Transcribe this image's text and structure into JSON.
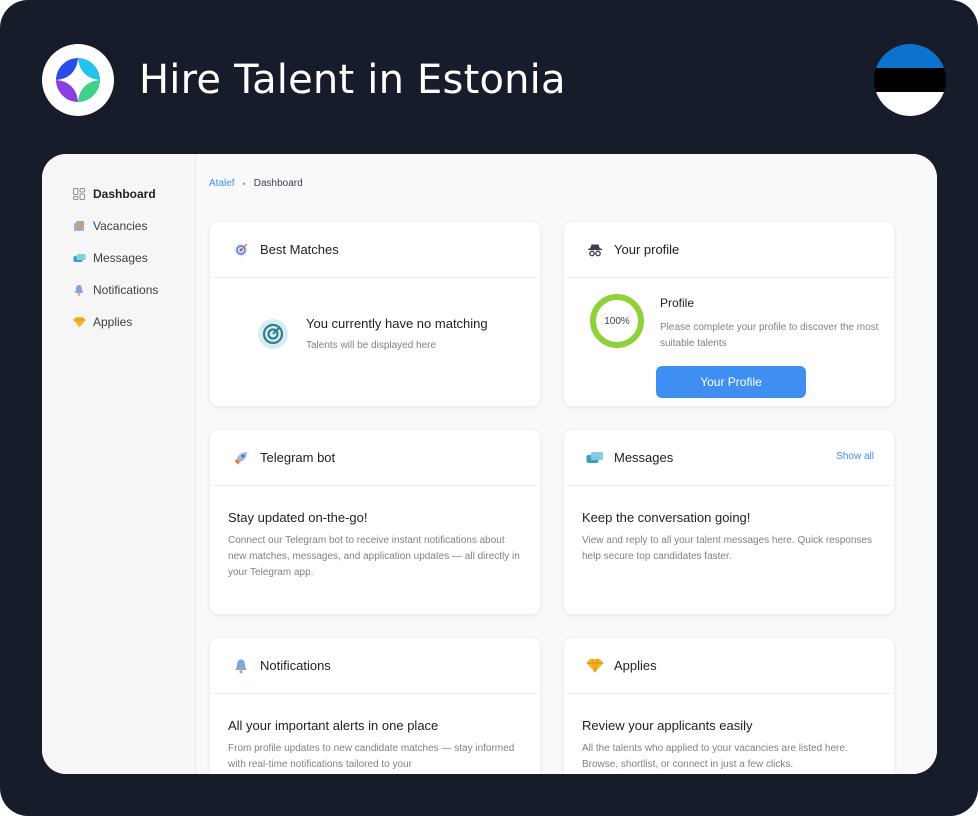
{
  "banner": {
    "headline": "Hire Talent in Estonia"
  },
  "flag": {
    "colors": [
      "#0b72ce",
      "#000000",
      "#ffffff"
    ]
  },
  "sidebar": {
    "items": [
      {
        "label": "Dashboard",
        "icon": "dashboard-icon",
        "active": true
      },
      {
        "label": "Vacancies",
        "icon": "vacancies-icon"
      },
      {
        "label": "Messages",
        "icon": "messages-icon"
      },
      {
        "label": "Notifications",
        "icon": "bell-icon"
      },
      {
        "label": "Applies",
        "icon": "diamond-icon"
      }
    ]
  },
  "breadcrumb": {
    "root": "Atalef",
    "separator": "•",
    "current": "Dashboard"
  },
  "cards": {
    "best_matches": {
      "title": "Best Matches",
      "icon": "target-icon",
      "empty_title": "You currently have no matching",
      "empty_text": "Talents will be displayed here"
    },
    "profile": {
      "title": "Your profile",
      "icon": "spy-icon",
      "progress_label": "100%",
      "progress": 1.0,
      "heading": "Profile",
      "text": "Please complete your profile to discover the most suitable talents",
      "button": "Your Profile"
    },
    "telegram": {
      "title": "Telegram bot",
      "icon": "rocket-icon",
      "heading": "Stay updated on-the-go!",
      "text": "Connect our Telegram bot to receive instant notifications about new matches, messages, and application updates — all directly in your Telegram app."
    },
    "messages": {
      "title": "Messages",
      "icon": "chat-icon",
      "link": "Show all",
      "heading": "Keep the conversation going!",
      "text": "View and reply to all your talent messages here. Quick responses help secure top candidates faster."
    },
    "notifications": {
      "title": "Notifications",
      "icon": "bell-icon",
      "heading": "All your important alerts in one place",
      "text": "From profile updates to new candidate matches — stay informed with real-time notifications tailored to your"
    },
    "applies": {
      "title": "Applies",
      "icon": "diamond-icon",
      "heading": "Review your applicants easily",
      "text": "All the talents who applied to your vacancies are listed here. Browse, shortlist, or connect in just a few clicks."
    }
  },
  "colors": {
    "accent": "#3f8ef2",
    "progress": "#8fd13a",
    "background": "#171c2b"
  }
}
